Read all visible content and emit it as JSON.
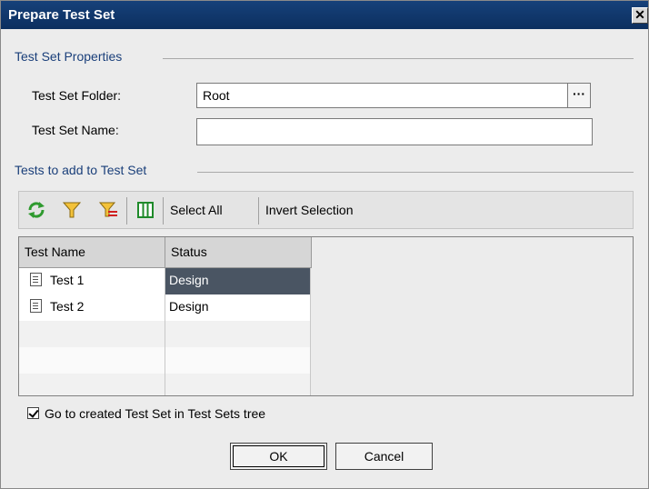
{
  "window": {
    "title": "Prepare Test Set",
    "close_glyph": "✕"
  },
  "properties": {
    "section_title": "Test Set Properties",
    "folder_label": "Test Set Folder:",
    "folder_value": "Root",
    "browse_label": "···",
    "name_label": "Test Set Name:",
    "name_value": ""
  },
  "tests": {
    "section_title": "Tests to add to Test Set",
    "toolbar": {
      "icons": [
        "refresh-icon",
        "filter-icon",
        "clear-filter-icon",
        "columns-icon"
      ],
      "select_all": "Select All",
      "invert_selection": "Invert Selection"
    },
    "columns": [
      "Test Name",
      "Status"
    ],
    "rows": [
      {
        "name": "Test 1",
        "status": "Design",
        "selected": true
      },
      {
        "name": "Test 2",
        "status": "Design",
        "selected": false
      }
    ]
  },
  "options": {
    "goto_label": "Go to created Test Set in Test Sets tree",
    "goto_checked": true
  },
  "buttons": {
    "ok": "OK",
    "cancel": "Cancel"
  },
  "colors": {
    "title_bar": "#0c2f5f",
    "section_text": "#1a3f7a",
    "selection": "#4a5563"
  }
}
